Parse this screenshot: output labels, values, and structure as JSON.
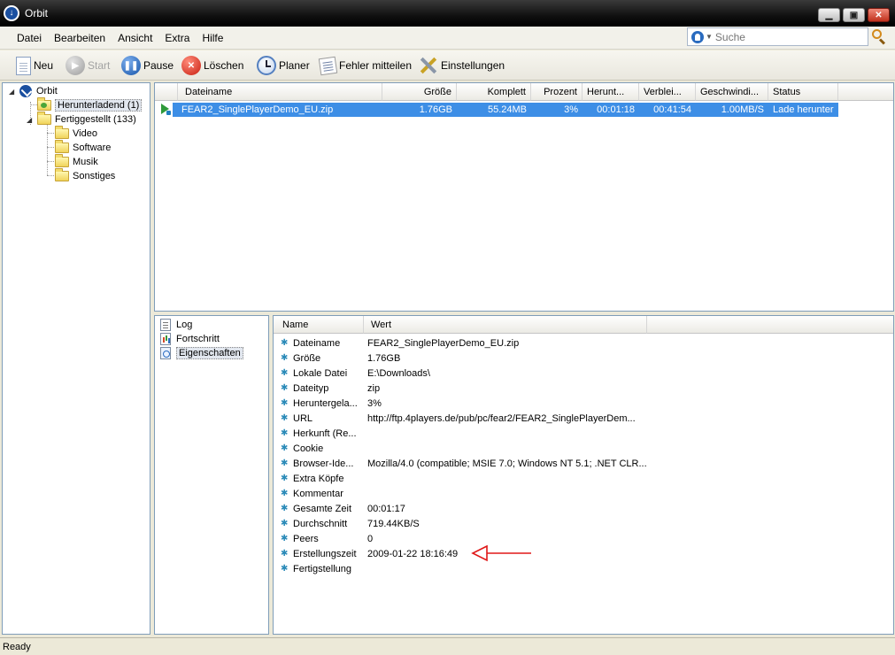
{
  "window": {
    "title": "Orbit"
  },
  "menu": [
    "Datei",
    "Bearbeiten",
    "Ansicht",
    "Extra",
    "Hilfe"
  ],
  "search": {
    "placeholder": "Suche"
  },
  "toolbar": {
    "new_label": "Neu",
    "start_label": "Start",
    "pause_label": "Pause",
    "delete_label": "Löschen",
    "scheduler_label": "Planer",
    "report_label": "Fehler mitteilen",
    "settings_label": "Einstellungen"
  },
  "tree": {
    "root": "Orbit",
    "downloading": "Herunterladend",
    "downloading_count": "(1)",
    "finished": "Fertiggestellt",
    "finished_count": "(133)",
    "categories": [
      "Video",
      "Software",
      "Musik",
      "Sonstiges"
    ]
  },
  "downloads": {
    "columns": [
      "Dateiname",
      "Größe",
      "Komplett",
      "Prozent",
      "Herunt...",
      "Verblei...",
      "Geschwindi...",
      "Status"
    ],
    "rows": [
      {
        "name": "FEAR2_SinglePlayerDemo_EU.zip",
        "size": "1.76GB",
        "complete": "55.24MB",
        "percent": "3%",
        "elapsed": "00:01:18",
        "remaining": "00:41:54",
        "speed": "1.00MB/S",
        "status": "Lade herunter"
      }
    ]
  },
  "info_nav": {
    "items": [
      "Log",
      "Fortschritt",
      "Eigenschaften"
    ],
    "selected": "Eigenschaften"
  },
  "properties": {
    "columns": [
      "Name",
      "Wert"
    ],
    "rows": [
      {
        "name": "Dateiname",
        "value": "FEAR2_SinglePlayerDemo_EU.zip"
      },
      {
        "name": "Größe",
        "value": "1.76GB"
      },
      {
        "name": "Lokale Datei",
        "value": "E:\\Downloads\\"
      },
      {
        "name": "Dateityp",
        "value": "zip"
      },
      {
        "name": "Heruntergela...",
        "value": "3%"
      },
      {
        "name": "URL",
        "value": "http://ftp.4players.de/pub/pc/fear2/FEAR2_SinglePlayerDem..."
      },
      {
        "name": "Herkunft (Re...",
        "value": ""
      },
      {
        "name": "Cookie",
        "value": ""
      },
      {
        "name": "Browser-Ide...",
        "value": "Mozilla/4.0 (compatible; MSIE 7.0; Windows NT 5.1; .NET CLR..."
      },
      {
        "name": "Extra Köpfe",
        "value": ""
      },
      {
        "name": "Kommentar",
        "value": ""
      },
      {
        "name": "Gesamte Zeit",
        "value": "00:01:17"
      },
      {
        "name": "Durchschnitt",
        "value": "719.44KB/S"
      },
      {
        "name": "Peers",
        "value": "0"
      },
      {
        "name": "Erstellungszeit",
        "value": "2009-01-22 18:16:49"
      },
      {
        "name": "Fertigstellung",
        "value": ""
      }
    ]
  },
  "annotation": {
    "color": "#e01818"
  },
  "status": {
    "text": "Ready"
  }
}
